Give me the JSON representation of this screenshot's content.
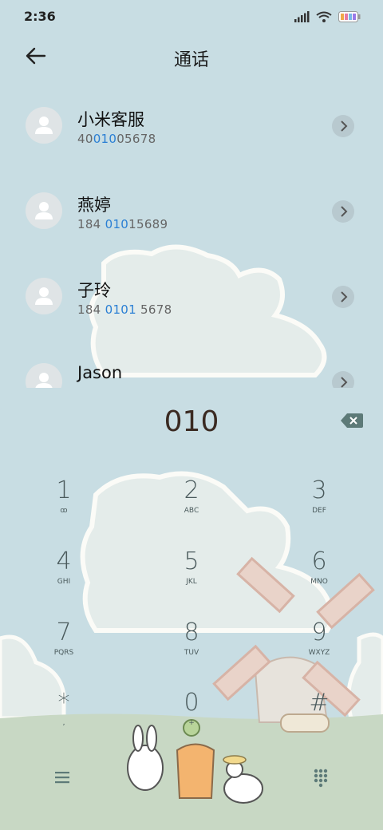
{
  "status": {
    "time": "2:36"
  },
  "header": {
    "title": "通话"
  },
  "contacts": [
    {
      "name": "小米客服",
      "num_pre": "40",
      "num_hl": "010",
      "num_post": "05678"
    },
    {
      "name": "燕婷",
      "num_pre": "184 ",
      "num_hl": "010",
      "num_post": "15689"
    },
    {
      "name": "子玲",
      "num_pre": "184 ",
      "num_hl": "0101",
      "num_post": " 5678"
    },
    {
      "name": "Jason",
      "num_pre": "",
      "num_hl": "",
      "num_post": ""
    }
  ],
  "dialer": {
    "input": "010",
    "keys": [
      {
        "digit": "1",
        "letters": "ꝏ"
      },
      {
        "digit": "2",
        "letters": "ABC"
      },
      {
        "digit": "3",
        "letters": "DEF"
      },
      {
        "digit": "4",
        "letters": "GHI"
      },
      {
        "digit": "5",
        "letters": "JKL"
      },
      {
        "digit": "6",
        "letters": "MNO"
      },
      {
        "digit": "7",
        "letters": "PQRS"
      },
      {
        "digit": "8",
        "letters": "TUV"
      },
      {
        "digit": "9",
        "letters": "WXYZ"
      },
      {
        "digit": "*",
        "letters": ","
      },
      {
        "digit": "0",
        "letters": "+"
      },
      {
        "digit": "#",
        "letters": ""
      }
    ]
  },
  "colors": {
    "accent": "#2a7fd4",
    "background": "#c8dde3"
  }
}
